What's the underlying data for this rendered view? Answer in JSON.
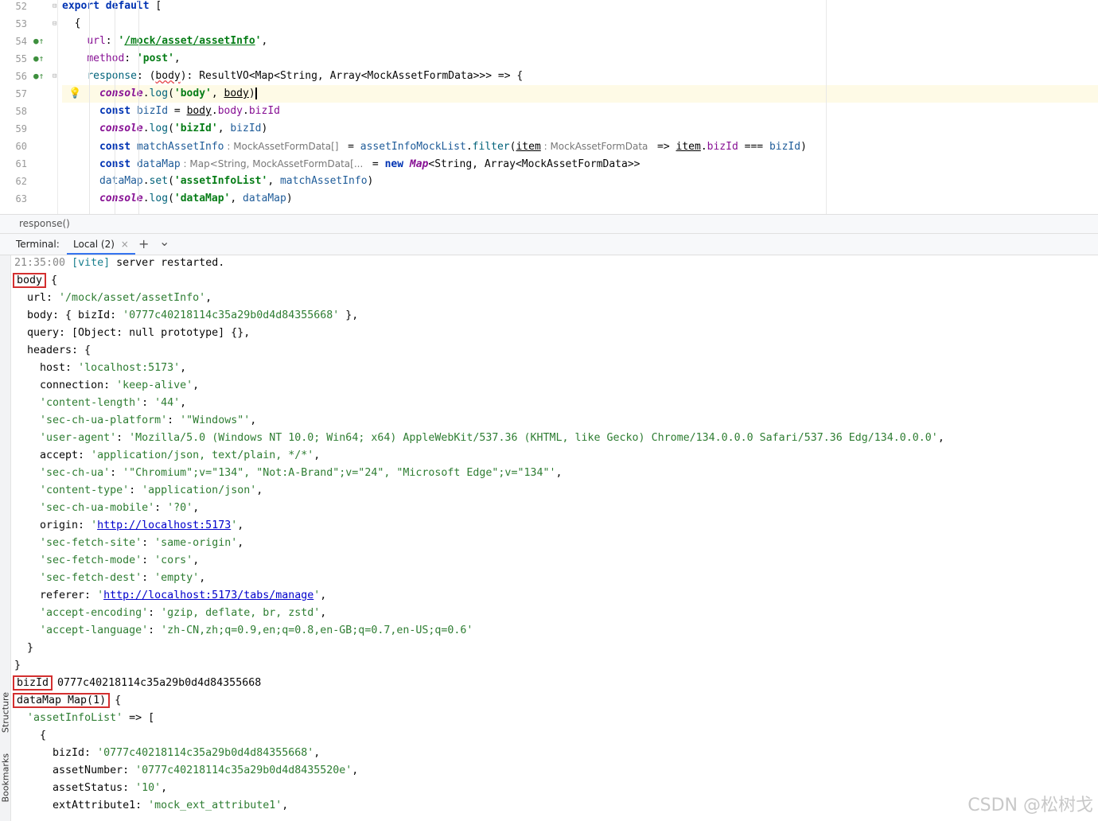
{
  "editor": {
    "line_numbers": [
      "52",
      "53",
      "54",
      "55",
      "56",
      "57",
      "58",
      "59",
      "60",
      "61",
      "62",
      "63"
    ],
    "lines": [
      [
        [
          "kw",
          "export"
        ],
        [
          "txt",
          " "
        ],
        [
          "kw",
          "default"
        ],
        [
          "txt",
          " ["
        ]
      ],
      [
        [
          "txt",
          "  {"
        ]
      ],
      [
        [
          "txt",
          "    "
        ],
        [
          "prop",
          "url"
        ],
        [
          "txt",
          ": "
        ],
        [
          "str",
          "'"
        ],
        [
          "str ul",
          "/mock/asset/assetInfo"
        ],
        [
          "str",
          "'"
        ],
        [
          "txt",
          ","
        ]
      ],
      [
        [
          "txt",
          "    "
        ],
        [
          "prop",
          "method"
        ],
        [
          "txt",
          ": "
        ],
        [
          "str",
          "'post'"
        ],
        [
          "txt",
          ","
        ]
      ],
      [
        [
          "txt",
          "    "
        ],
        [
          "fn",
          "response"
        ],
        [
          "txt",
          ": ("
        ],
        [
          "err",
          "body"
        ],
        [
          "txt",
          "): ResultVO<Map<String, Array<MockAssetFormData>>> => {"
        ]
      ],
      [
        [
          "txt",
          "      "
        ],
        [
          "obj",
          "console"
        ],
        [
          "txt",
          "."
        ],
        [
          "fn",
          "log"
        ],
        [
          "txt",
          "("
        ],
        [
          "str",
          "'body'"
        ],
        [
          "txt",
          ", "
        ],
        [
          "var",
          "body"
        ],
        [
          "caret",
          ")"
        ]
      ],
      [
        [
          "txt",
          "      "
        ],
        [
          "kw",
          "const"
        ],
        [
          "txt",
          " "
        ],
        [
          "lvar",
          "bizId"
        ],
        [
          "txt",
          " = "
        ],
        [
          "var",
          "body"
        ],
        [
          "txt",
          "."
        ],
        [
          "prop",
          "body"
        ],
        [
          "txt",
          "."
        ],
        [
          "prop",
          "bizId"
        ]
      ],
      [
        [
          "txt",
          "      "
        ],
        [
          "obj",
          "console"
        ],
        [
          "txt",
          "."
        ],
        [
          "fn",
          "log"
        ],
        [
          "txt",
          "("
        ],
        [
          "str",
          "'bizId'"
        ],
        [
          "txt",
          ", "
        ],
        [
          "lvar",
          "bizId"
        ],
        [
          "txt",
          ")"
        ]
      ],
      [
        [
          "txt",
          "      "
        ],
        [
          "kw",
          "const"
        ],
        [
          "txt",
          " "
        ],
        [
          "lvar",
          "matchAssetInfo"
        ],
        [
          "hint",
          " : MockAssetFormData[] "
        ],
        [
          "txt",
          " = "
        ],
        [
          "lvar",
          "assetInfoMockList"
        ],
        [
          "txt",
          "."
        ],
        [
          "fn",
          "filter"
        ],
        [
          "txt",
          "("
        ],
        [
          "var",
          "item"
        ],
        [
          "hint",
          " : MockAssetFormData "
        ],
        [
          "txt",
          " => "
        ],
        [
          "var",
          "item"
        ],
        [
          "txt",
          "."
        ],
        [
          "prop",
          "bizId"
        ],
        [
          "txt",
          " === "
        ],
        [
          "lvar",
          "bizId"
        ],
        [
          "txt",
          ")"
        ]
      ],
      [
        [
          "txt",
          "      "
        ],
        [
          "kw",
          "const"
        ],
        [
          "txt",
          " "
        ],
        [
          "lvar",
          "dataMap"
        ],
        [
          "hint",
          " : Map<String, MockAssetFormData[... "
        ],
        [
          "txt",
          " = "
        ],
        [
          "kw",
          "new"
        ],
        [
          "txt",
          " "
        ],
        [
          "obj",
          "Map"
        ],
        [
          "txt",
          "<String, Array<MockAssetFormData>>"
        ]
      ],
      [
        [
          "txt",
          "      "
        ],
        [
          "lvar",
          "dataMap"
        ],
        [
          "txt",
          "."
        ],
        [
          "fn",
          "set"
        ],
        [
          "txt",
          "("
        ],
        [
          "str",
          "'assetInfoList'"
        ],
        [
          "txt",
          ", "
        ],
        [
          "lvar",
          "matchAssetInfo"
        ],
        [
          "txt",
          ")"
        ]
      ],
      [
        [
          "txt",
          "      "
        ],
        [
          "obj",
          "console"
        ],
        [
          "txt",
          "."
        ],
        [
          "fn",
          "log"
        ],
        [
          "txt",
          "("
        ],
        [
          "str",
          "'dataMap'"
        ],
        [
          "txt",
          ", "
        ],
        [
          "lvar",
          "dataMap"
        ],
        [
          "txt",
          ")"
        ]
      ]
    ]
  },
  "breadcrumb": "response()",
  "terminal_bar": {
    "label": "Terminal:",
    "tab": "Local (2)",
    "close": "×",
    "add": "+",
    "dropdown": "⌄"
  },
  "sidebar_labels": {
    "structure": "Structure",
    "bookmarks": "Bookmarks"
  },
  "terminal": [
    [
      [
        "ts",
        "21:35:00 "
      ],
      [
        "vite",
        "[vite]"
      ],
      [
        "txt",
        " server restarted."
      ]
    ],
    [
      [
        "hl",
        "body"
      ],
      [
        "txt",
        " {"
      ]
    ],
    [
      [
        "txt",
        "  url: "
      ],
      [
        "g",
        "'/mock/asset/assetInfo'"
      ],
      [
        "txt",
        ","
      ]
    ],
    [
      [
        "txt",
        "  body: { bizId: "
      ],
      [
        "g",
        "'0777c40218114c35a29b0d4d84355668'"
      ],
      [
        "txt",
        " },"
      ]
    ],
    [
      [
        "txt",
        "  query: [Object: null prototype] {},"
      ]
    ],
    [
      [
        "txt",
        "  headers: {"
      ]
    ],
    [
      [
        "txt",
        "    host: "
      ],
      [
        "g",
        "'localhost:5173'"
      ],
      [
        "txt",
        ","
      ]
    ],
    [
      [
        "txt",
        "    connection: "
      ],
      [
        "g",
        "'keep-alive'"
      ],
      [
        "txt",
        ","
      ]
    ],
    [
      [
        "txt",
        "    "
      ],
      [
        "g",
        "'content-length'"
      ],
      [
        "txt",
        ": "
      ],
      [
        "g",
        "'44'"
      ],
      [
        "txt",
        ","
      ]
    ],
    [
      [
        "txt",
        "    "
      ],
      [
        "g",
        "'sec-ch-ua-platform'"
      ],
      [
        "txt",
        ": "
      ],
      [
        "g",
        "'\"Windows\"'"
      ],
      [
        "txt",
        ","
      ]
    ],
    [
      [
        "txt",
        "    "
      ],
      [
        "g",
        "'user-agent'"
      ],
      [
        "txt",
        ": "
      ],
      [
        "g",
        "'Mozilla/5.0 (Windows NT 10.0; Win64; x64) AppleWebKit/537.36 (KHTML, like Gecko) Chrome/134.0.0.0 Safari/537.36 Edg/134.0.0.0'"
      ],
      [
        "txt",
        ","
      ]
    ],
    [
      [
        "txt",
        "    accept: "
      ],
      [
        "g",
        "'application/json, text/plain, */*'"
      ],
      [
        "txt",
        ","
      ]
    ],
    [
      [
        "txt",
        "    "
      ],
      [
        "g",
        "'sec-ch-ua'"
      ],
      [
        "txt",
        ": "
      ],
      [
        "g",
        "'\"Chromium\";v=\"134\", \"Not:A-Brand\";v=\"24\", \"Microsoft Edge\";v=\"134\"'"
      ],
      [
        "txt",
        ","
      ]
    ],
    [
      [
        "txt",
        "    "
      ],
      [
        "g",
        "'content-type'"
      ],
      [
        "txt",
        ": "
      ],
      [
        "g",
        "'application/json'"
      ],
      [
        "txt",
        ","
      ]
    ],
    [
      [
        "txt",
        "    "
      ],
      [
        "g",
        "'sec-ch-ua-mobile'"
      ],
      [
        "txt",
        ": "
      ],
      [
        "g",
        "'?0'"
      ],
      [
        "txt",
        ","
      ]
    ],
    [
      [
        "txt",
        "    origin: "
      ],
      [
        "g",
        "'"
      ],
      [
        "link",
        "http://localhost:5173"
      ],
      [
        "g",
        "'"
      ],
      [
        "txt",
        ","
      ]
    ],
    [
      [
        "txt",
        "    "
      ],
      [
        "g",
        "'sec-fetch-site'"
      ],
      [
        "txt",
        ": "
      ],
      [
        "g",
        "'same-origin'"
      ],
      [
        "txt",
        ","
      ]
    ],
    [
      [
        "txt",
        "    "
      ],
      [
        "g",
        "'sec-fetch-mode'"
      ],
      [
        "txt",
        ": "
      ],
      [
        "g",
        "'cors'"
      ],
      [
        "txt",
        ","
      ]
    ],
    [
      [
        "txt",
        "    "
      ],
      [
        "g",
        "'sec-fetch-dest'"
      ],
      [
        "txt",
        ": "
      ],
      [
        "g",
        "'empty'"
      ],
      [
        "txt",
        ","
      ]
    ],
    [
      [
        "txt",
        "    referer: "
      ],
      [
        "g",
        "'"
      ],
      [
        "link",
        "http://localhost:5173/tabs/manage"
      ],
      [
        "g",
        "'"
      ],
      [
        "txt",
        ","
      ]
    ],
    [
      [
        "txt",
        "    "
      ],
      [
        "g",
        "'accept-encoding'"
      ],
      [
        "txt",
        ": "
      ],
      [
        "g",
        "'gzip, deflate, br, zstd'"
      ],
      [
        "txt",
        ","
      ]
    ],
    [
      [
        "txt",
        "    "
      ],
      [
        "g",
        "'accept-language'"
      ],
      [
        "txt",
        ": "
      ],
      [
        "g",
        "'zh-CN,zh;q=0.9,en;q=0.8,en-GB;q=0.7,en-US;q=0.6'"
      ]
    ],
    [
      [
        "txt",
        "  }"
      ]
    ],
    [
      [
        "txt",
        "}"
      ]
    ],
    [
      [
        "hl",
        "bizId"
      ],
      [
        "txt",
        " 0777c40218114c35a29b0d4d84355668"
      ]
    ],
    [
      [
        "hl",
        "dataMap Map(1)"
      ],
      [
        "txt",
        " {"
      ]
    ],
    [
      [
        "txt",
        "  "
      ],
      [
        "g",
        "'assetInfoList'"
      ],
      [
        "txt",
        " => ["
      ]
    ],
    [
      [
        "txt",
        "    {"
      ]
    ],
    [
      [
        "txt",
        "      bizId: "
      ],
      [
        "g",
        "'0777c40218114c35a29b0d4d84355668'"
      ],
      [
        "txt",
        ","
      ]
    ],
    [
      [
        "txt",
        "      assetNumber: "
      ],
      [
        "g",
        "'0777c40218114c35a29b0d4d8435520e'"
      ],
      [
        "txt",
        ","
      ]
    ],
    [
      [
        "txt",
        "      assetStatus: "
      ],
      [
        "g",
        "'10'"
      ],
      [
        "txt",
        ","
      ]
    ],
    [
      [
        "txt",
        "      extAttribute1: "
      ],
      [
        "g",
        "'mock_ext_attribute1'"
      ],
      [
        "txt",
        ","
      ]
    ]
  ],
  "watermark": "CSDN @松树戈"
}
